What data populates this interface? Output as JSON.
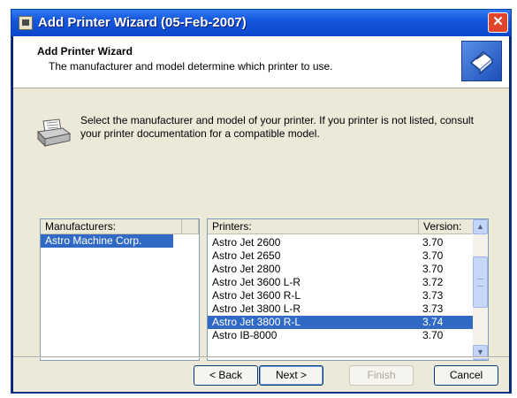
{
  "window": {
    "title": "Add Printer Wizard (05-Feb-2007)",
    "close_label": "✕"
  },
  "header": {
    "title": "Add Printer Wizard",
    "subtitle": "The manufacturer and model determine which printer to use."
  },
  "instruction": "Select the manufacturer and model of your printer. If you printer is not listed, consult your printer documentation for a compatible model.",
  "manufacturers": {
    "header": "Manufacturers:",
    "items": [
      "Astro Machine Corp."
    ],
    "selected_index": 0
  },
  "printers": {
    "header_name": "Printers:",
    "header_version": "Version:",
    "rows": [
      {
        "name": "Astro Jet 2600",
        "version": "3.70"
      },
      {
        "name": "Astro Jet 2650",
        "version": "3.70"
      },
      {
        "name": "Astro Jet 2800",
        "version": "3.70"
      },
      {
        "name": "Astro Jet 3600 L-R",
        "version": "3.72"
      },
      {
        "name": "Astro Jet 3600 R-L",
        "version": "3.73"
      },
      {
        "name": "Astro Jet 3800 L-R",
        "version": "3.73"
      },
      {
        "name": "Astro Jet 3800 R-L",
        "version": "3.74"
      },
      {
        "name": "Astro IB-8000",
        "version": "3.70"
      }
    ],
    "selected_index": 6
  },
  "buttons": {
    "back": "< Back",
    "next": "Next >",
    "finish": "Finish",
    "cancel": "Cancel"
  },
  "colors": {
    "titlebar": "#0b48c9",
    "selection": "#316ac5",
    "dialog_bg": "#ece9d8"
  }
}
